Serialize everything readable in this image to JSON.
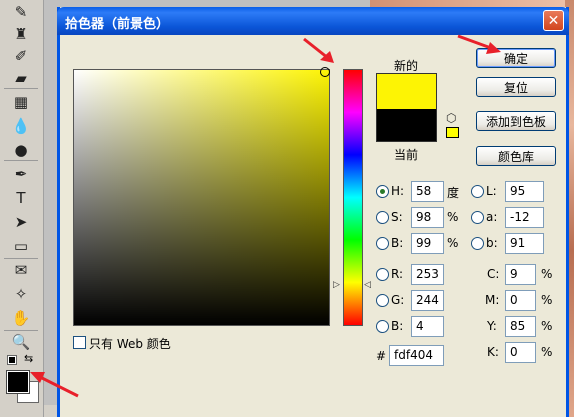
{
  "dialog": {
    "title": "拾色器（前景色）",
    "close_label": "✕"
  },
  "swatches": {
    "new_label": "新的",
    "current_label": "当前",
    "new_color": "#fdf404",
    "current_color": "#000000"
  },
  "buttons": {
    "ok": "确定",
    "reset": "复位",
    "add_swatch": "添加到色板",
    "color_library": "颜色库"
  },
  "hsb": {
    "h_label": "H:",
    "h_value": "58",
    "h_unit": "度",
    "s_label": "S:",
    "s_value": "98",
    "s_unit": "%",
    "b_label": "B:",
    "b_value": "99",
    "b_unit": "%"
  },
  "rgb": {
    "r_label": "R:",
    "r_value": "253",
    "g_label": "G:",
    "g_value": "244",
    "b_label": "B:",
    "b_value": "4"
  },
  "lab": {
    "l_label": "L:",
    "l_value": "95",
    "a_label": "a:",
    "a_value": "-12",
    "b_label": "b:",
    "b_value": "91"
  },
  "cmyk": {
    "c_label": "C:",
    "c_value": "9",
    "m_label": "M:",
    "m_value": "0",
    "y_label": "Y:",
    "y_value": "85",
    "k_label": "K:",
    "k_value": "0",
    "unit": "%"
  },
  "hex": {
    "label": "#",
    "value": "fdf404"
  },
  "web_only_label": "只有 Web 颜色",
  "toolbar": {
    "tools": [
      "brush-icon",
      "stamp-icon",
      "history-brush-icon",
      "eraser-icon",
      "gradient-icon",
      "blur-icon",
      "dodge-icon",
      "pen-icon",
      "type-icon",
      "path-select-icon",
      "rectangle-shape-icon",
      "notes-icon",
      "eyedropper-icon",
      "hand-icon",
      "zoom-icon"
    ],
    "glyphs": [
      "✎",
      "♜",
      "✐",
      "▰",
      "▦",
      "💧",
      "●",
      "✒",
      "T",
      "➤",
      "▭",
      "✉",
      "✧",
      "✋",
      "🔍"
    ]
  },
  "colors": {
    "accent": "#0055e5",
    "annotation": "#e8202a"
  }
}
